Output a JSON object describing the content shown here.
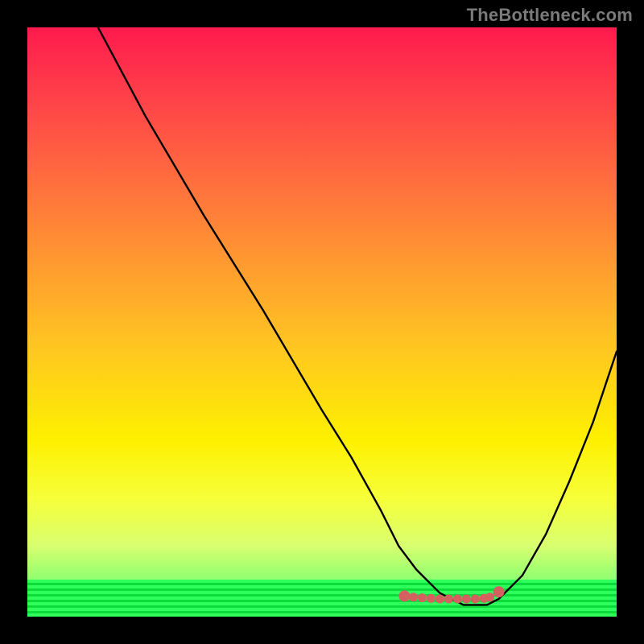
{
  "attribution": "TheBottleneck.com",
  "colors": {
    "background": "#000000",
    "gradient_top": "#ff1a4d",
    "gradient_bottom": "#2fff5c",
    "curve": "#000000",
    "dots": "#d46060"
  },
  "chart_data": {
    "type": "line",
    "title": "",
    "xlabel": "",
    "ylabel": "",
    "xlim": [
      0,
      100
    ],
    "ylim": [
      0,
      100
    ],
    "series": [
      {
        "name": "bottleneck-curve",
        "x": [
          12,
          20,
          30,
          40,
          50,
          55,
          60,
          63,
          66,
          70,
          74,
          78,
          80,
          84,
          88,
          92,
          96,
          100
        ],
        "values": [
          100,
          85,
          68,
          52,
          35,
          27,
          18,
          12,
          8,
          4,
          2,
          2,
          3,
          7,
          14,
          23,
          33,
          45
        ]
      }
    ],
    "dots": {
      "x": [
        64,
        65.5,
        67,
        68.5,
        70,
        71.5,
        73,
        74.5,
        76,
        77.5,
        78.5,
        80
      ],
      "values": [
        3.5,
        3.3,
        3.2,
        3.1,
        3.0,
        3.0,
        3.0,
        3.0,
        3.0,
        3.1,
        3.3,
        4.2
      ]
    }
  }
}
